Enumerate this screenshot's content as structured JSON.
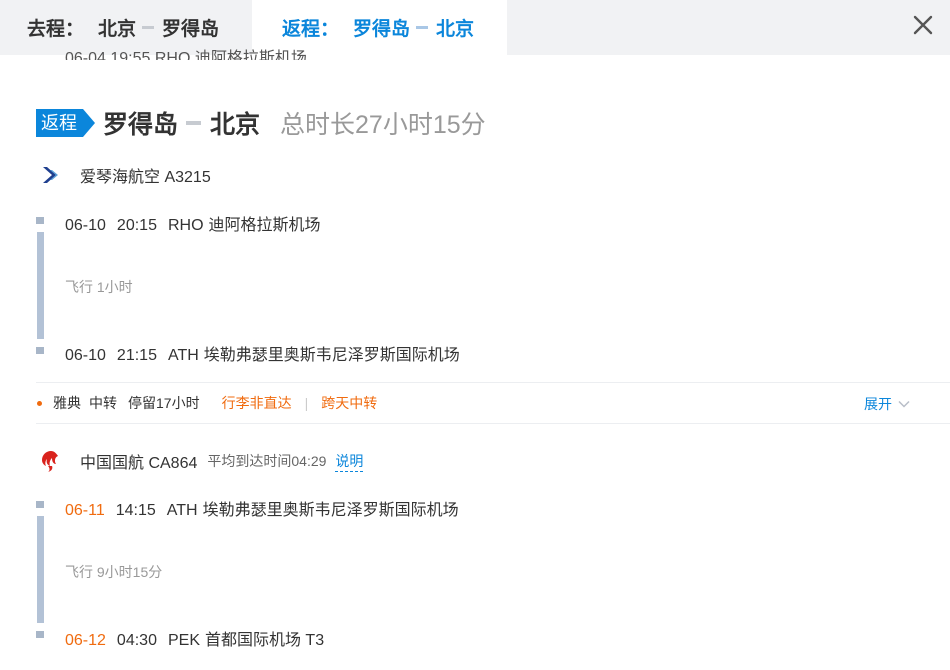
{
  "tabs": {
    "outbound": {
      "prefix": "去程：",
      "from": "北京",
      "to": "罗得岛"
    },
    "return": {
      "prefix": "返程：",
      "from": "罗得岛",
      "to": "北京"
    }
  },
  "cutoff_row": {
    "text": "06-04  19:55  RHO 迪阿格拉斯机场"
  },
  "return_route": {
    "badge": "返程",
    "from": "罗得岛",
    "to": "北京",
    "duration": "总时长27小时15分"
  },
  "segments": [
    {
      "airline": "爱琴海航空 A3215",
      "logo_icon": "aegean-airlines-logo-icon",
      "depart": {
        "date": "06-10",
        "time": "20:15",
        "code": "RHO",
        "airport": "迪阿格拉斯机场"
      },
      "flight_time": "飞行 1小时",
      "arrive": {
        "date": "06-10",
        "time": "21:15",
        "code": "ATH",
        "airport": "埃勒弗瑟里奥斯韦尼泽罗斯国际机场"
      }
    },
    {
      "airline": "中国国航 CA864",
      "logo_icon": "air-china-logo-icon",
      "avg_arrival": "平均到达时间04:29",
      "explain": "说明",
      "depart": {
        "date": "06-11",
        "time": "14:15",
        "code": "ATH",
        "airport": "埃勒弗瑟里奥斯韦尼泽罗斯国际机场"
      },
      "flight_time": "飞行 9小时15分",
      "arrive": {
        "date": "06-12",
        "time": "04:30",
        "code": "PEK",
        "airport": "首都国际机场 T3"
      }
    }
  ],
  "transfer": {
    "city": "雅典",
    "kind": "中转",
    "stay": "停留17小时",
    "tag1": "行李非直达",
    "tag2": "跨天中转",
    "expand": "展开"
  },
  "colors": {
    "accent": "#0b86db",
    "warning": "#f06b0f",
    "timeline": "#b3c2d6"
  }
}
